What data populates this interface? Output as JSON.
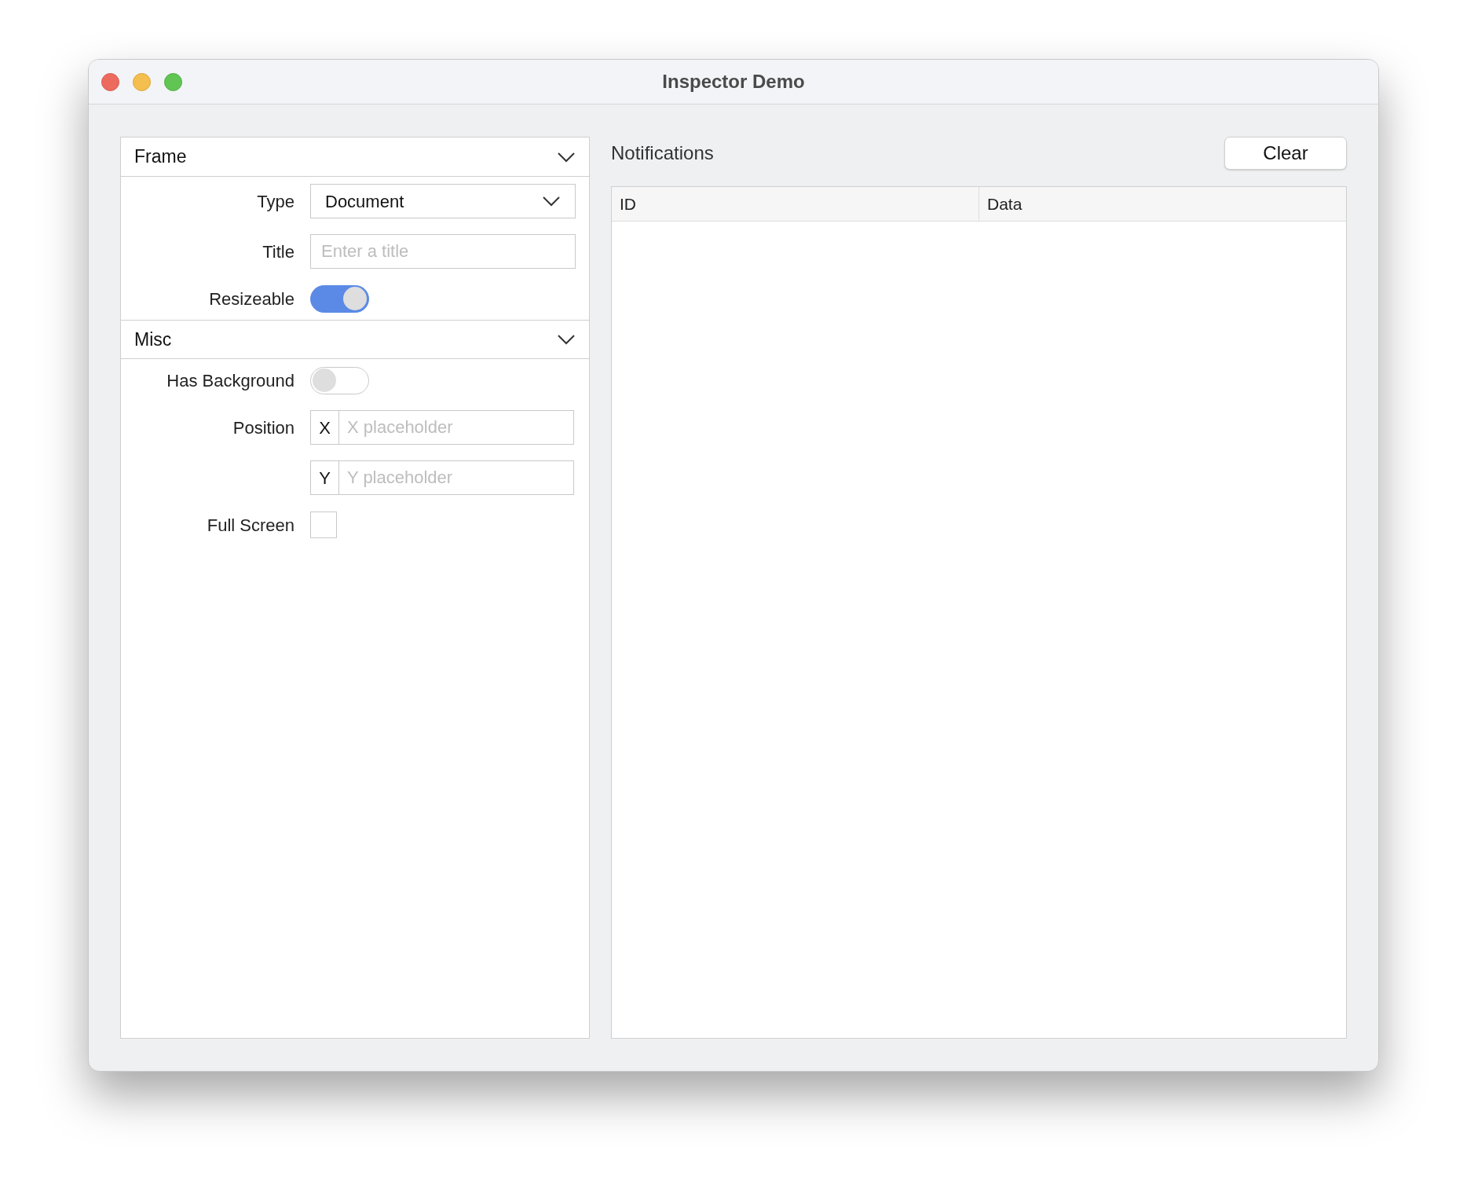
{
  "window": {
    "title": "Inspector Demo"
  },
  "inspector": {
    "sections": [
      {
        "title": "Frame",
        "expanded": true,
        "rows": [
          {
            "kind": "select",
            "label": "Type",
            "value": "Document"
          },
          {
            "kind": "text",
            "label": "Title",
            "placeholder": "Enter a title"
          },
          {
            "kind": "toggle",
            "label": "Resizeable",
            "on": true
          }
        ]
      },
      {
        "title": "Misc",
        "expanded": true,
        "rows": [
          {
            "kind": "toggle",
            "label": "Has Background",
            "on": false
          },
          {
            "kind": "coords",
            "label": "Position",
            "fields": [
              {
                "prefix": "X",
                "placeholder": "X placeholder"
              },
              {
                "prefix": "Y",
                "placeholder": "Y placeholder"
              }
            ]
          },
          {
            "kind": "checkbox",
            "label": "Full Screen",
            "checked": false
          }
        ]
      }
    ]
  },
  "notifications": {
    "title": "Notifications",
    "clear_button": "Clear",
    "table": {
      "columns": [
        "ID",
        "Data"
      ]
    }
  }
}
